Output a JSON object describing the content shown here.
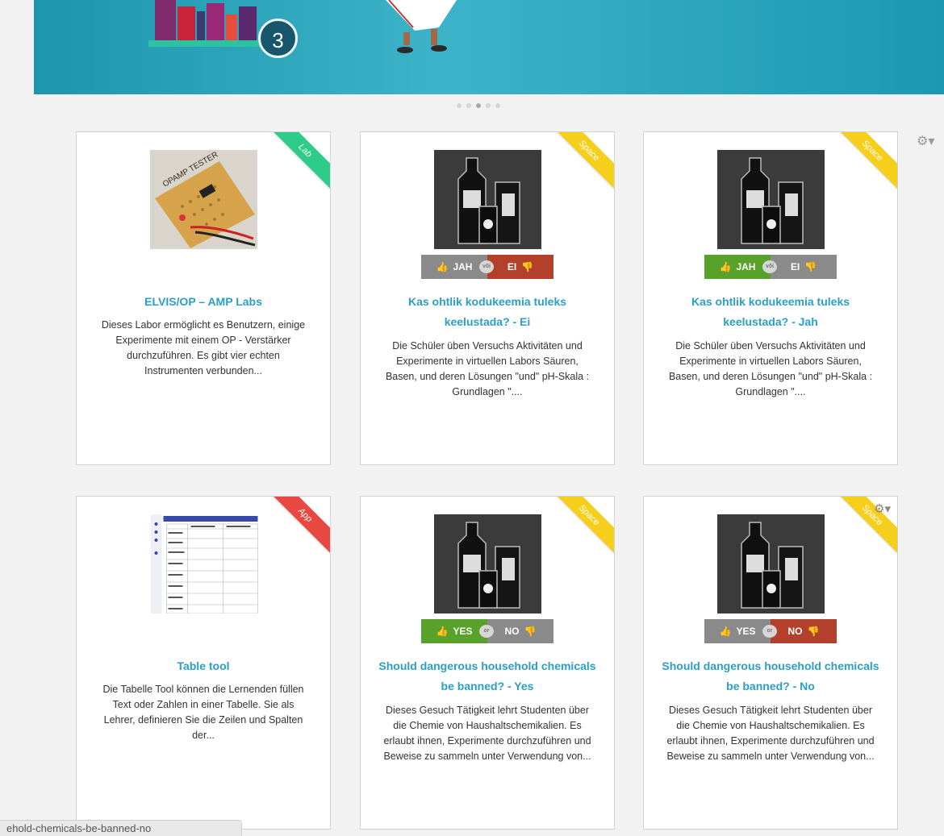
{
  "hero": {
    "slide_number": "3"
  },
  "carousel": {
    "dots": 5,
    "active_index": 2
  },
  "cards": [
    {
      "ribbon": "Lab",
      "ribbon_color": "#2ecc8a",
      "thumbnail": "circuit-board-photo",
      "title": "ELVIS/OP – AMP Labs",
      "description": "Dieses Labor ermöglicht es Benutzern, einige Experimente mit einem OP - Verstärker durchzuführen. Es gibt vier echten Instrumenten verbunden..."
    },
    {
      "ribbon": "Space",
      "ribbon_color": "#f5cf1c",
      "thumbnail": "chemical-bottles-illustration",
      "vote": {
        "yes": "JAH",
        "or": "või",
        "no": "EI",
        "selected": "no"
      },
      "title": "Kas ohtlik kodukeemia tuleks keelustada? - Ei",
      "description": "Die Schüler üben Versuchs Aktivitäten und Experimente in virtuellen Labors Säuren, Basen, und deren Lösungen \"und\" pH-Skala : Grundlagen \"...."
    },
    {
      "ribbon": "Space",
      "ribbon_color": "#f5cf1c",
      "thumbnail": "chemical-bottles-illustration",
      "vote": {
        "yes": "JAH",
        "or": "või",
        "no": "EI",
        "selected": "yes"
      },
      "title": "Kas ohtlik kodukeemia tuleks keelustada? - Jah",
      "description": "Die Schüler üben Versuchs Aktivitäten und Experimente in virtuellen Labors Säuren, Basen, und deren Lösungen \"und\" pH-Skala : Grundlagen \"...."
    },
    {
      "ribbon": "App",
      "ribbon_color": "#e8483f",
      "thumbnail": "table-tool-screenshot",
      "title": "Table tool",
      "description": "Die Tabelle Tool können die Lernenden füllen Text oder Zahlen in einer Tabelle. Sie als Lehrer, definieren Sie die Zeilen und Spalten der..."
    },
    {
      "ribbon": "Space",
      "ribbon_color": "#f5cf1c",
      "thumbnail": "chemical-bottles-illustration",
      "vote": {
        "yes": "YES",
        "or": "or",
        "no": "NO",
        "selected": "yes"
      },
      "title": "Should dangerous household chemicals be banned? - Yes",
      "description": "Dieses Gesuch Tätigkeit lehrt Studenten über die Chemie von Haushaltschemikalien. Es erlaubt ihnen, Experimente durchzuführen und Beweise zu sammeln unter Verwendung von..."
    },
    {
      "ribbon": "Space",
      "ribbon_color": "#f5cf1c",
      "thumbnail": "chemical-bottles-illustration",
      "vote": {
        "yes": "YES",
        "or": "or",
        "no": "NO",
        "selected": "no"
      },
      "title": "Should dangerous household chemicals be banned? - No",
      "description": "Dieses Gesuch Tätigkeit lehrt Studenten über die Chemie von Haushaltschemikalien. Es erlaubt ihnen, Experimente durchzuführen und Beweise zu sammeln unter Verwendung von..."
    }
  ],
  "colors": {
    "yes_active": "#58a12a",
    "no_active": "#b3402a",
    "inactive": "#8a8a8a",
    "title": "#2b9fc4"
  },
  "status_bar": {
    "url": "ehold-chemicals-be-banned-no"
  }
}
